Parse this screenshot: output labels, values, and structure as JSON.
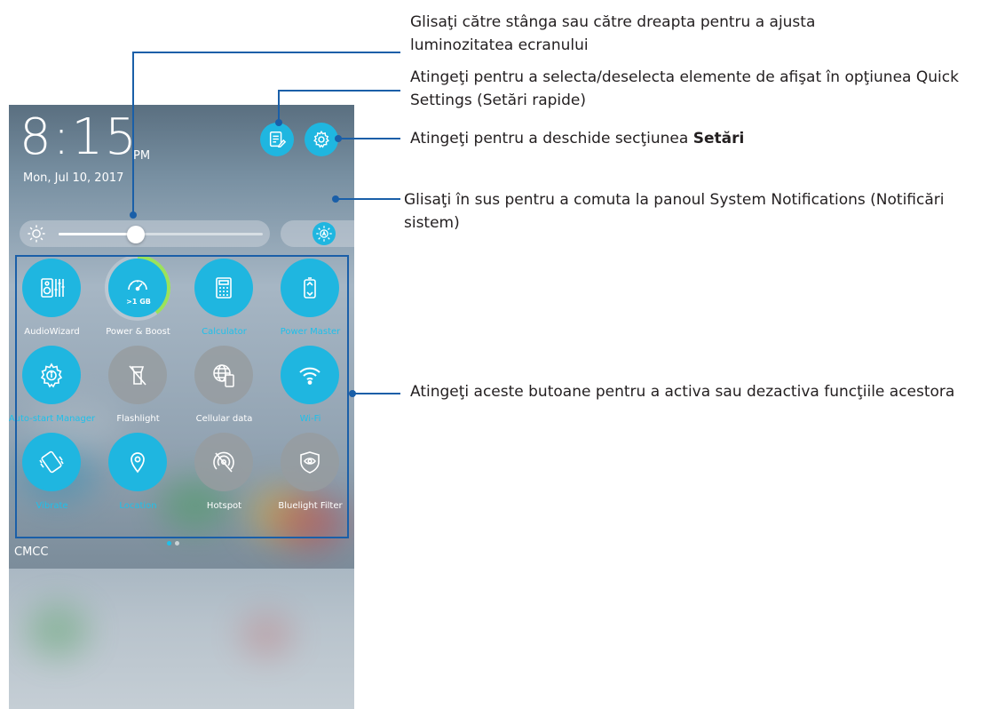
{
  "status": {
    "time": "8:15",
    "ampm": "PM",
    "date": "Mon, Jul 10, 2017",
    "carrier": "CMCC"
  },
  "brightness": {
    "level_percent": 38
  },
  "icons": {
    "edit": "edit-list-icon",
    "settings": "gear-icon",
    "brightness": "sun-icon",
    "auto_brightness": "auto-brightness-icon"
  },
  "tiles": [
    {
      "label": "AudioWizard",
      "state": "on",
      "icon": "speaker-equalizer-icon"
    },
    {
      "label": "Power & Boost",
      "state": "on",
      "icon": "speedometer-icon",
      "badge": ">1 GB"
    },
    {
      "label": "Calculator",
      "state": "on",
      "icon": "calculator-icon"
    },
    {
      "label": "Power Master",
      "state": "on",
      "icon": "battery-icon"
    },
    {
      "label": "Auto-start Manager",
      "state": "on",
      "icon": "gear-info-icon"
    },
    {
      "label": "Flashlight",
      "state": "off",
      "icon": "flashlight-off-icon"
    },
    {
      "label": "Cellular data",
      "state": "off",
      "icon": "globe-phone-icon"
    },
    {
      "label": "Wi-Fi",
      "state": "on",
      "icon": "wifi-icon"
    },
    {
      "label": "Vibrate",
      "state": "on",
      "icon": "vibrate-icon"
    },
    {
      "label": "Location",
      "state": "on",
      "icon": "location-pin-icon"
    },
    {
      "label": "Hotspot",
      "state": "off",
      "icon": "hotspot-off-icon"
    },
    {
      "label": "Bluelight Filter",
      "state": "off",
      "icon": "eye-shield-icon"
    }
  ],
  "pager": {
    "pages": 2,
    "current": 1
  },
  "colors": {
    "accent": "#1fb6e0",
    "callout": "#1a5fa8"
  },
  "annotations": {
    "brightness": "Glisaţi către stânga sau către dreapta pentru a ajusta luminozitatea ecranului",
    "quick_settings": "Atingeţi pentru a selecta/deselecta elemente de afişat în opţiunea Quick Settings (Setări rapide)",
    "settings_prefix": "Atingeţi pentru a deschide secţiunea ",
    "settings_bold": "Setări",
    "notifications": "Glisaţi în sus pentru a comuta la panoul System Notifications (Notificări sistem)",
    "toggles": "Atingeţi aceste butoane pentru a activa sau dezactiva funcţiile acestora"
  }
}
